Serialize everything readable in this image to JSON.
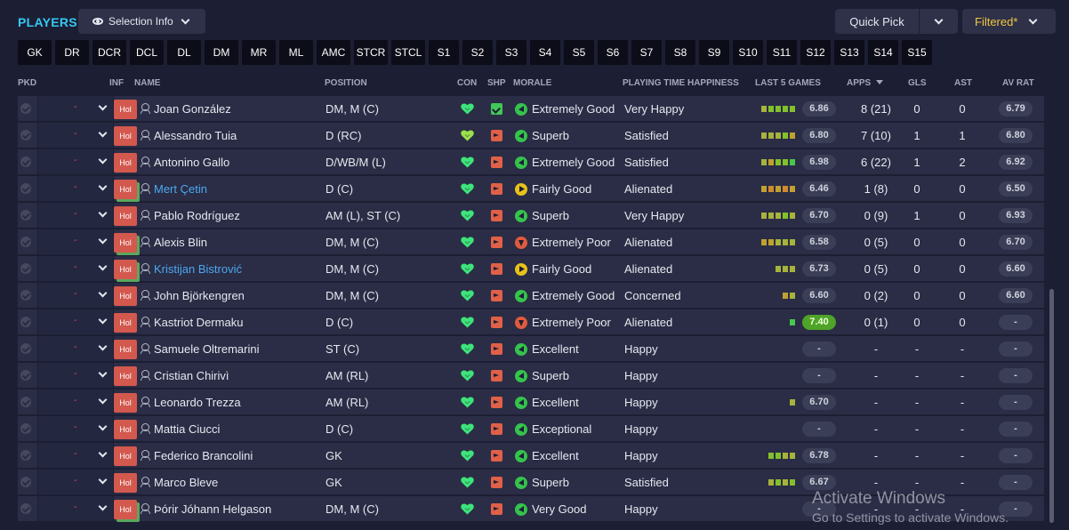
{
  "header": {
    "title": "PLAYERS",
    "selection_info": "Selection Info",
    "quick_pick": "Quick Pick",
    "filtered": "Filtered*"
  },
  "positions": [
    "GK",
    "DR",
    "DCR",
    "DCL",
    "DL",
    "DM",
    "MR",
    "ML",
    "AMC",
    "STCR",
    "STCL",
    "S1",
    "S2",
    "S3",
    "S4",
    "S5",
    "S6",
    "S7",
    "S8",
    "S9",
    "S10",
    "S11",
    "S12",
    "S13",
    "S14",
    "S15"
  ],
  "columns": {
    "pkd": "PKD",
    "inf": "INF",
    "name": "NAME",
    "position": "POSITION",
    "con": "CON",
    "shp": "SHP",
    "morale": "MORALE",
    "pth": "PLAYING TIME HAPPINESS",
    "last5": "LAST 5 GAMES",
    "apps": "APPS",
    "gls": "GLS",
    "ast": "AST",
    "avrat": "AV RAT"
  },
  "colors": {
    "accent": "#35c8f2",
    "filtered": "#f0c840",
    "inf_badge": "#d3584e",
    "con_green": "#3ee37a",
    "con_light": "#9be04a",
    "morale_green": "#35c24d",
    "morale_yellow": "#e8c21c",
    "morale_red": "#e05a3d"
  },
  "players": [
    {
      "inf": "Hol",
      "name": "Joan González",
      "highlight": false,
      "dbl": false,
      "position": "DM, M (C)",
      "con": "full",
      "shp": "green",
      "morale_icon": "up",
      "morale": "Extremely Good",
      "pth": "Very Happy",
      "bars": [
        "#a7b33b",
        "#82c02c",
        "#82c02c",
        "#82c02c",
        "#82c02c"
      ],
      "last5": "6.86",
      "last5_hi": false,
      "apps": "8 (21)",
      "gls": "0",
      "ast": "0",
      "avrat": "6.79"
    },
    {
      "inf": "Hol",
      "name": "Alessandro Tuia",
      "highlight": false,
      "dbl": false,
      "position": "D (RC)",
      "con": "light",
      "shp": "red",
      "morale_icon": "up",
      "morale": "Superb",
      "pth": "Satisfied",
      "bars": [
        "#a7b33b",
        "#a7b33b",
        "#a7b33b",
        "#82c02c",
        "#c0a030"
      ],
      "last5": "6.80",
      "last5_hi": false,
      "apps": "7 (10)",
      "gls": "1",
      "ast": "1",
      "avrat": "6.80"
    },
    {
      "inf": "Hol",
      "name": "Antonino Gallo",
      "highlight": false,
      "dbl": false,
      "position": "D/WB/M (L)",
      "con": "full",
      "shp": "red",
      "morale_icon": "up",
      "morale": "Extremely Good",
      "pth": "Satisfied",
      "bars": [
        "#a7b33b",
        "#c0a030",
        "#82c02c",
        "#82c02c",
        "#48c84a"
      ],
      "last5": "6.98",
      "last5_hi": false,
      "apps": "6 (22)",
      "gls": "1",
      "ast": "2",
      "avrat": "6.92"
    },
    {
      "inf": "Hol",
      "name": "Mert Çetin",
      "highlight": true,
      "dbl": true,
      "position": "D (C)",
      "con": "full",
      "shp": "red",
      "morale_icon": "side",
      "morale": "Fairly Good",
      "pth": "Alienated",
      "bars": [
        "#c0a030",
        "#d08a30",
        "#c0a030",
        "#d08a30",
        "#c0a030"
      ],
      "last5": "6.46",
      "last5_hi": false,
      "apps": "1 (8)",
      "gls": "0",
      "ast": "0",
      "avrat": "6.50"
    },
    {
      "inf": "Hol",
      "name": "Pablo Rodríguez",
      "highlight": false,
      "dbl": false,
      "position": "AM (L), ST (C)",
      "con": "full",
      "shp": "red",
      "morale_icon": "up",
      "morale": "Superb",
      "pth": "Very Happy",
      "bars": [
        "#a7b33b",
        "#a7b33b",
        "#a7b33b",
        "#82c02c",
        "#a7b33b"
      ],
      "last5": "6.70",
      "last5_hi": false,
      "apps": "0 (9)",
      "gls": "1",
      "ast": "0",
      "avrat": "6.93"
    },
    {
      "inf": "Hol",
      "name": "Alexis Blin",
      "highlight": false,
      "dbl": true,
      "position": "DM, M (C)",
      "con": "full",
      "shp": "red",
      "morale_icon": "down",
      "morale": "Extremely Poor",
      "pth": "Alienated",
      "bars": [
        "#c0a030",
        "#c0a030",
        "#a7b33b",
        "#a7b33b",
        "#a7b33b"
      ],
      "last5": "6.58",
      "last5_hi": false,
      "apps": "0 (5)",
      "gls": "0",
      "ast": "0",
      "avrat": "6.70"
    },
    {
      "inf": "Hol",
      "name": "Kristijan Bistrović",
      "highlight": true,
      "dbl": true,
      "position": "DM, M (C)",
      "con": "full",
      "shp": "red",
      "morale_icon": "side",
      "morale": "Fairly Good",
      "pth": "Alienated",
      "bars": [
        "#a7b33b",
        "#a7b33b",
        "#a7b33b"
      ],
      "last5": "6.73",
      "last5_hi": false,
      "apps": "0 (5)",
      "gls": "0",
      "ast": "0",
      "avrat": "6.60"
    },
    {
      "inf": "Hol",
      "name": "John Björkengren",
      "highlight": false,
      "dbl": false,
      "position": "DM, M (C)",
      "con": "full",
      "shp": "red",
      "morale_icon": "up",
      "morale": "Extremely Good",
      "pth": "Concerned",
      "bars": [
        "#c0a030",
        "#a7b33b"
      ],
      "last5": "6.60",
      "last5_hi": false,
      "apps": "0 (2)",
      "gls": "0",
      "ast": "0",
      "avrat": "6.60"
    },
    {
      "inf": "Hol",
      "name": "Kastriot Dermaku",
      "highlight": false,
      "dbl": false,
      "position": "D (C)",
      "con": "full",
      "shp": "red",
      "morale_icon": "down",
      "morale": "Extremely Poor",
      "pth": "Alienated",
      "bars": [
        "#48c84a"
      ],
      "last5": "7.40",
      "last5_hi": true,
      "apps": "0 (1)",
      "gls": "0",
      "ast": "0",
      "avrat": "-"
    },
    {
      "inf": "Hol",
      "name": "Samuele Oltremarini",
      "highlight": false,
      "dbl": false,
      "position": "ST (C)",
      "con": "full",
      "shp": "red",
      "morale_icon": "up",
      "morale": "Excellent",
      "pth": "Happy",
      "bars": [],
      "last5": "-",
      "last5_hi": false,
      "apps": "-",
      "gls": "-",
      "ast": "-",
      "avrat": "-"
    },
    {
      "inf": "Hol",
      "name": "Cristian Chirivì",
      "highlight": false,
      "dbl": false,
      "position": "AM (RL)",
      "con": "full",
      "shp": "red",
      "morale_icon": "up",
      "morale": "Superb",
      "pth": "Happy",
      "bars": [],
      "last5": "-",
      "last5_hi": false,
      "apps": "-",
      "gls": "-",
      "ast": "-",
      "avrat": "-"
    },
    {
      "inf": "Hol",
      "name": "Leonardo Trezza",
      "highlight": false,
      "dbl": false,
      "position": "AM (RL)",
      "con": "full",
      "shp": "red",
      "morale_icon": "up",
      "morale": "Excellent",
      "pth": "Happy",
      "bars": [
        "#a7b33b"
      ],
      "last5": "6.70",
      "last5_hi": false,
      "apps": "-",
      "gls": "-",
      "ast": "-",
      "avrat": "-"
    },
    {
      "inf": "Hol",
      "name": "Mattia Ciucci",
      "highlight": false,
      "dbl": false,
      "position": "D (C)",
      "con": "full",
      "shp": "red",
      "morale_icon": "up",
      "morale": "Exceptional",
      "pth": "Happy",
      "bars": [],
      "last5": "-",
      "last5_hi": false,
      "apps": "-",
      "gls": "-",
      "ast": "-",
      "avrat": "-"
    },
    {
      "inf": "Hol",
      "name": "Federico Brancolini",
      "highlight": false,
      "dbl": false,
      "position": "GK",
      "con": "full",
      "shp": "red",
      "morale_icon": "up",
      "morale": "Excellent",
      "pth": "Happy",
      "bars": [
        "#82c02c",
        "#82c02c",
        "#a7b33b",
        "#a7b33b"
      ],
      "last5": "6.78",
      "last5_hi": false,
      "apps": "-",
      "gls": "-",
      "ast": "-",
      "avrat": "-"
    },
    {
      "inf": "Hol",
      "name": "Marco Bleve",
      "highlight": false,
      "dbl": false,
      "position": "GK",
      "con": "full",
      "shp": "red",
      "morale_icon": "up",
      "morale": "Superb",
      "pth": "Satisfied",
      "bars": [
        "#a7b33b",
        "#82c02c",
        "#a7b33b",
        "#82c02c"
      ],
      "last5": "6.67",
      "last5_hi": false,
      "apps": "-",
      "gls": "-",
      "ast": "-",
      "avrat": "-"
    },
    {
      "inf": "Hol",
      "name": "Þórir Jóhann Helgason",
      "highlight": false,
      "dbl": true,
      "position": "DM, M (C)",
      "con": "full",
      "shp": "red",
      "morale_icon": "up",
      "morale": "Very Good",
      "pth": "Happy",
      "bars": [],
      "last5": "-",
      "last5_hi": false,
      "apps": "-",
      "gls": "-",
      "ast": "-",
      "avrat": "-"
    }
  ],
  "row_select_value": "-",
  "watermark": {
    "line1": "Activate Windows",
    "line2": "Go to Settings to activate Windows."
  }
}
